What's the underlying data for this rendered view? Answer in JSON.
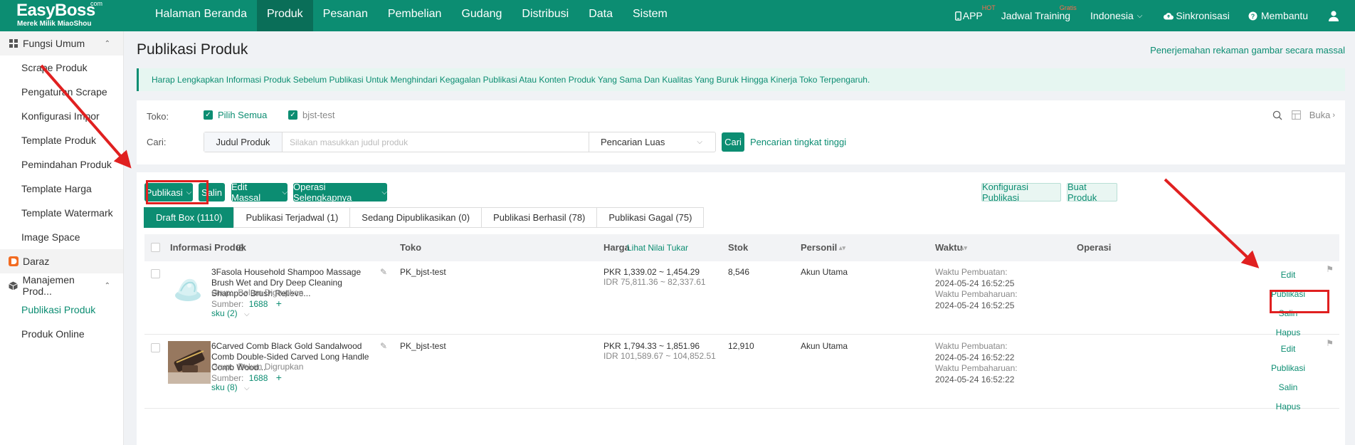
{
  "brand": {
    "name": "EasyBoss",
    "com": "com",
    "tagline": "Merek Milik MiaoShou"
  },
  "topnav": {
    "items": [
      "Halaman Beranda",
      "Produk",
      "Pesanan",
      "Pembelian",
      "Gudang",
      "Distribusi",
      "Data",
      "Sistem"
    ],
    "active": "Produk",
    "app_label": "APP",
    "app_badge": "HOT",
    "training_label": "Jadwal Training",
    "training_badge": "Gratis",
    "language": "Indonesia",
    "sync_label": "Sinkronisasi",
    "help_label": "Membantu"
  },
  "sidebar": {
    "group1": "Fungsi Umum",
    "group1_items": [
      "Scrape Produk",
      "Pengaturan Scrape",
      "Konfigurasi Impor",
      "Template Produk",
      "Pemindahan Produk",
      "Template Harga",
      "Template Watermark",
      "Image Space"
    ],
    "group2": "Daraz",
    "group3": "Manajemen Prod...",
    "group3_items": [
      "Publikasi Produk",
      "Produk Online"
    ],
    "active": "Publikasi Produk"
  },
  "page": {
    "title": "Publikasi Produk",
    "top_link": "Penerjemahan rekaman gambar secara massal",
    "notice": "Harap Lengkapkan Informasi Produk Sebelum Publikasi Untuk Menghindari Kegagalan Publikasi Atau Konten Produk Yang Sama Dan Kualitas Yang Buruk Hingga Kinerja Toko Terpengaruh."
  },
  "filter": {
    "store_label": "Toko:",
    "select_all": "Pilih Semua",
    "store_name": "bjst-test",
    "search_label": "Cari:",
    "search_type": "Judul Produk",
    "search_placeholder": "Silakan masukkan judul produk",
    "search_mode": "Pencarian Luas",
    "search_button": "Cari",
    "advanced_search": "Pencarian tingkat tinggi",
    "expand_label": "Buka"
  },
  "toolbar": {
    "publish": "Publikasi",
    "copy": "Salin",
    "bulk_edit": "Edit Massal",
    "more_ops": "Operasi Selengkapnya",
    "publish_config": "Konfigurasi Publikasi",
    "create_product": "Buat Produk"
  },
  "tabs": [
    "Draft Box (1110)",
    "Publikasi Terjadwal (1)",
    "Sedang Dipublikasikan (0)",
    "Publikasi Berhasil (78)",
    "Publikasi Gagal (75)"
  ],
  "table": {
    "headers": {
      "product_info": "Informasi Produk",
      "store": "Toko",
      "price": "Harga",
      "exchange_link": "Lihat Nilai Tukar",
      "stock": "Stok",
      "personnel": "Personil",
      "time": "Waktu",
      "operation": "Operasi"
    },
    "rows": [
      {
        "title": "3Fasola Household Shampoo Massage Brush Wet and Dry Deep Cleaning Shampoo Brush Relieve...",
        "group_label": "Grup:",
        "group": "Belum Digrupkan",
        "source_label": "Sumber:",
        "source": "1688",
        "sku": "sku (2)",
        "store": "PK_bjst-test",
        "price_pkr": "PKR 1,339.02 ~ 1,454.29",
        "price_idr": "IDR 75,811.36 ~ 82,337.61",
        "stock": "8,546",
        "personnel": "Akun Utama",
        "created_label": "Waktu Pembuatan:",
        "created": "2024-05-24 16:52:25",
        "updated_label": "Waktu Pembaharuan:",
        "updated": "2024-05-24 16:52:25",
        "ops": [
          "Edit",
          "Publikasi",
          "Salin",
          "Hapus"
        ]
      },
      {
        "title": "6Carved Comb Black Gold Sandalwood Comb Double-Sided Carved Long Handle Comb Wood...",
        "group_label": "Grup:",
        "group": "Belum Digrupkan",
        "source_label": "Sumber:",
        "source": "1688",
        "sku": "sku (8)",
        "store": "PK_bjst-test",
        "price_pkr": "PKR 1,794.33 ~ 1,851.96",
        "price_idr": "IDR 101,589.67 ~ 104,852.51",
        "stock": "12,910",
        "personnel": "Akun Utama",
        "created_label": "Waktu Pembuatan:",
        "created": "2024-05-24 16:52:22",
        "updated_label": "Waktu Pembaharuan:",
        "updated": "2024-05-24 16:52:22",
        "ops": [
          "Edit",
          "Publikasi",
          "Salin",
          "Hapus"
        ]
      }
    ]
  },
  "colors": {
    "brand": "#0c8d72",
    "annotation": "#e02020"
  }
}
